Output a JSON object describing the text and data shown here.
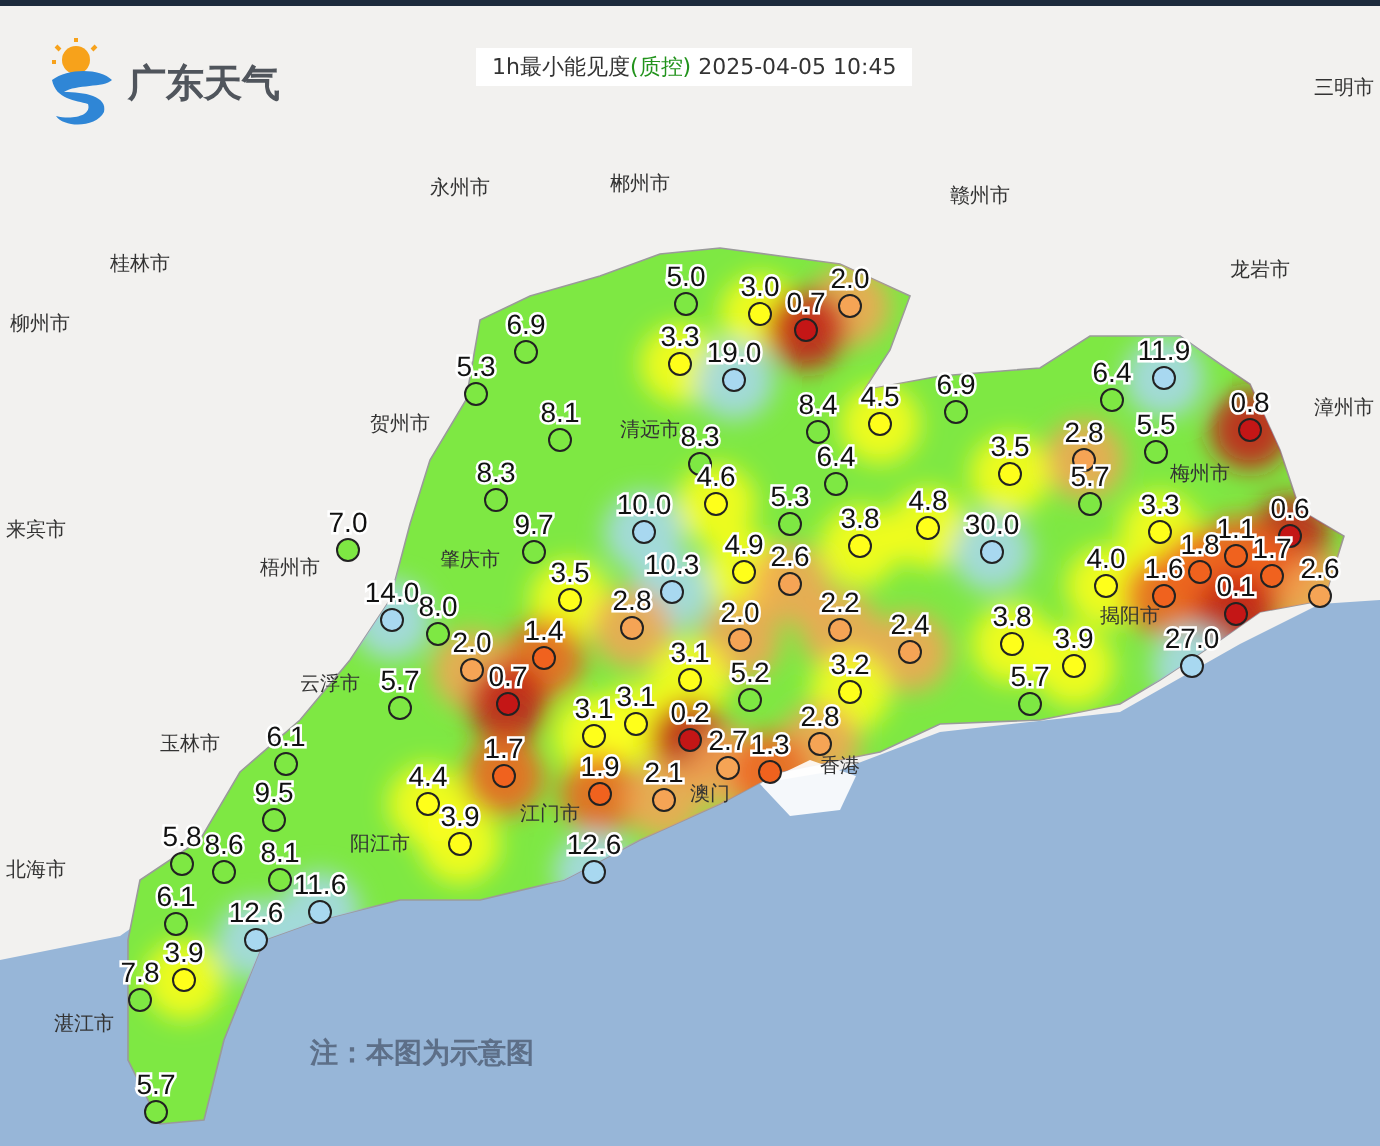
{
  "brand": {
    "name": "广东天气"
  },
  "title": {
    "product": "1h最小能见度",
    "qc": "(质控)",
    "time": "2025-04-05 10:45"
  },
  "cities": [
    {
      "name": "三明市"
    },
    {
      "name": "永州市"
    },
    {
      "name": "郴州市"
    },
    {
      "name": "赣州市"
    },
    {
      "name": "桂林市"
    },
    {
      "name": "龙岩市"
    },
    {
      "name": "柳州市"
    },
    {
      "name": "漳州市"
    },
    {
      "name": "贺州市"
    },
    {
      "name": "清远市"
    },
    {
      "name": "梅州市"
    },
    {
      "name": "来宾市"
    },
    {
      "name": "肇庆市"
    },
    {
      "name": "梧州市"
    },
    {
      "name": "揭阳市"
    },
    {
      "name": "云浮市"
    },
    {
      "name": "玉林市"
    },
    {
      "name": "香港"
    },
    {
      "name": "澳门"
    },
    {
      "name": "江门市"
    },
    {
      "name": "阳江市"
    },
    {
      "name": "北海市"
    },
    {
      "name": "湛江市"
    }
  ],
  "stations": [
    {
      "value": "5.0"
    },
    {
      "value": "3.0"
    },
    {
      "value": "2.0"
    },
    {
      "value": "0.7"
    },
    {
      "value": "6.9"
    },
    {
      "value": "3.3"
    },
    {
      "value": "19.0"
    },
    {
      "value": "11.9"
    },
    {
      "value": "5.3"
    },
    {
      "value": "6.4"
    },
    {
      "value": "4.5"
    },
    {
      "value": "6.9"
    },
    {
      "value": "8.1"
    },
    {
      "value": "8.4"
    },
    {
      "value": "0.8"
    },
    {
      "value": "8.3"
    },
    {
      "value": "2.8"
    },
    {
      "value": "5.5"
    },
    {
      "value": "6.4"
    },
    {
      "value": "3.5"
    },
    {
      "value": "8.3"
    },
    {
      "value": "4.6"
    },
    {
      "value": "5.7"
    },
    {
      "value": "10.0"
    },
    {
      "value": "5.3"
    },
    {
      "value": "4.8"
    },
    {
      "value": "3.3"
    },
    {
      "value": "0.6"
    },
    {
      "value": "7.0"
    },
    {
      "value": "9.7"
    },
    {
      "value": "3.8"
    },
    {
      "value": "30.0"
    },
    {
      "value": "1.1"
    },
    {
      "value": "4.9"
    },
    {
      "value": "1.8"
    },
    {
      "value": "2.6"
    },
    {
      "value": "4.0"
    },
    {
      "value": "1.7"
    },
    {
      "value": "3.5"
    },
    {
      "value": "10.3"
    },
    {
      "value": "1.6"
    },
    {
      "value": "2.6"
    },
    {
      "value": "14.0"
    },
    {
      "value": "0.1"
    },
    {
      "value": "8.0"
    },
    {
      "value": "2.8"
    },
    {
      "value": "2.0"
    },
    {
      "value": "2.2"
    },
    {
      "value": "2.4"
    },
    {
      "value": "3.8"
    },
    {
      "value": "2.0"
    },
    {
      "value": "1.4"
    },
    {
      "value": "3.9"
    },
    {
      "value": "27.0"
    },
    {
      "value": "3.1"
    },
    {
      "value": "3.2"
    },
    {
      "value": "5.7"
    },
    {
      "value": "0.7"
    },
    {
      "value": "5.2"
    },
    {
      "value": "5.7"
    },
    {
      "value": "3.1"
    },
    {
      "value": "3.1"
    },
    {
      "value": "0.2"
    },
    {
      "value": "2.8"
    },
    {
      "value": "6.1"
    },
    {
      "value": "1.7"
    },
    {
      "value": "2.7"
    },
    {
      "value": "1.3"
    },
    {
      "value": "4.4"
    },
    {
      "value": "1.9"
    },
    {
      "value": "2.1"
    },
    {
      "value": "9.5"
    },
    {
      "value": "3.9"
    },
    {
      "value": "5.8"
    },
    {
      "value": "8.6"
    },
    {
      "value": "8.1"
    },
    {
      "value": "12.6"
    },
    {
      "value": "6.1"
    },
    {
      "value": "11.6"
    },
    {
      "value": "12.6"
    },
    {
      "value": "3.9"
    },
    {
      "value": "7.8"
    },
    {
      "value": "5.7"
    }
  ],
  "note": "注：本图为示意图"
}
